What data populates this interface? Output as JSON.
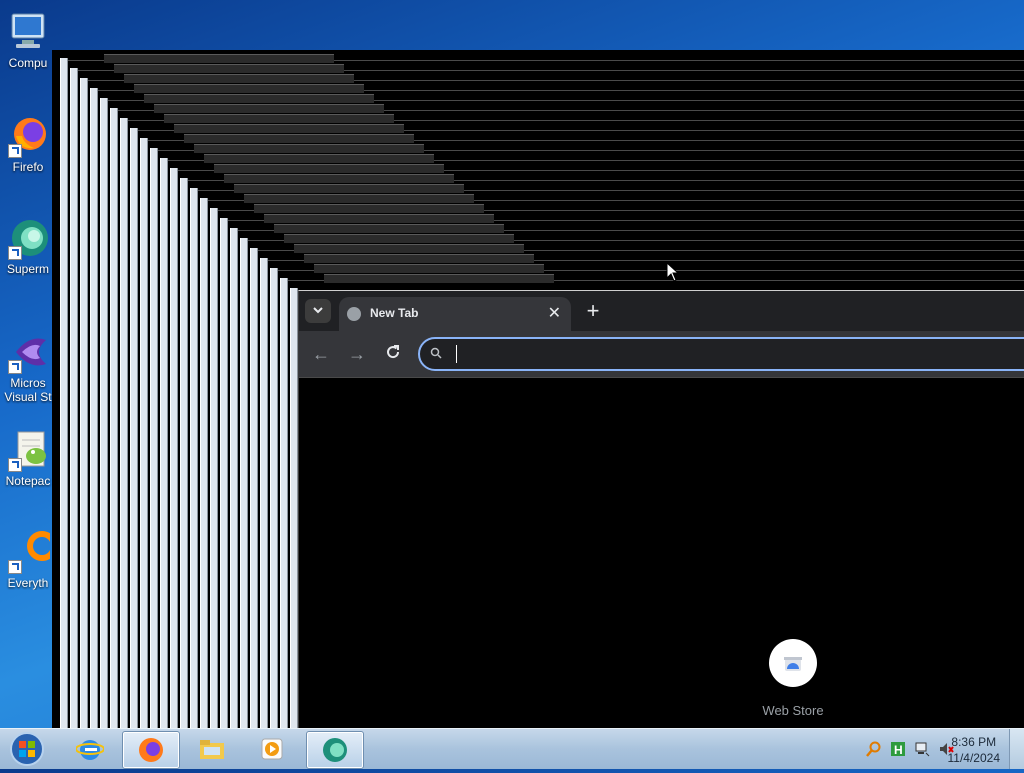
{
  "desktop": {
    "icons": [
      {
        "label": "Compu",
        "icon": "computer-icon"
      },
      {
        "label": "Firefo",
        "icon": "firefox-icon"
      },
      {
        "label": "Superm",
        "icon": "supermium-icon"
      },
      {
        "label": "Micros",
        "label2": "Visual St",
        "icon": "visual-studio-icon"
      },
      {
        "label": "Notepac",
        "icon": "notepad-plus-plus-icon"
      },
      {
        "label": "Everyth",
        "icon": "everything-icon"
      }
    ]
  },
  "browser": {
    "tab_title": "New Tab",
    "tab_close_glyph": "✕",
    "new_tab_glyph": "+",
    "back_glyph": "←",
    "forward_glyph": "→",
    "omnibox_value": "",
    "shortcut_label": "Web Store"
  },
  "taskbar": {
    "apps": [
      {
        "icon": "internet-explorer-icon"
      },
      {
        "icon": "firefox-icon",
        "active": true
      },
      {
        "icon": "file-explorer-icon"
      },
      {
        "icon": "media-player-icon"
      },
      {
        "icon": "supermium-icon",
        "active": true
      }
    ],
    "tray_icons": [
      "search-tray-icon",
      "h-tray-icon",
      "network-icon",
      "volume-muted-icon"
    ],
    "time": "8:36 PM",
    "date": "11/4/2024"
  },
  "colors": {
    "accent": "#8ab4f8",
    "tab_bg": "#35363a",
    "tabstrip_bg": "#202124"
  }
}
